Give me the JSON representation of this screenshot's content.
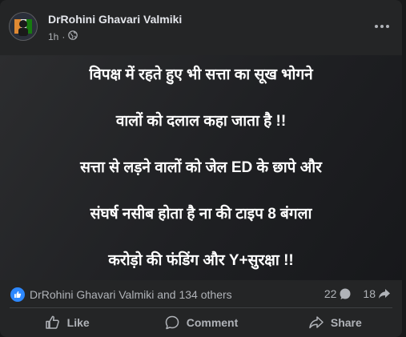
{
  "post": {
    "author": "DrRohini Ghavari Valmiki",
    "time": "1h",
    "visibility_icon": "globe-icon",
    "more_icon": "more-options-icon",
    "image_text": [
      "विपक्ष में रहते हुए भी सत्ता का सूख भोगने",
      "वालों को दलाल कहा जाता है !!",
      "सत्ता से लड़ने वालों को जेल ED के छापे और",
      "संघर्ष नसीब होता है ना की टाइप 8 बंगला",
      "करोड़ो की फंडिंग और Y+सुरक्षा !!"
    ]
  },
  "reactions": {
    "names": "DrRohini Ghavari Valmiki and 134 others",
    "comments_count": "22",
    "shares_count": "18",
    "like_badge_color": "#2d88ff"
  },
  "actions": {
    "like_label": "Like",
    "comment_label": "Comment",
    "share_label": "Share"
  }
}
